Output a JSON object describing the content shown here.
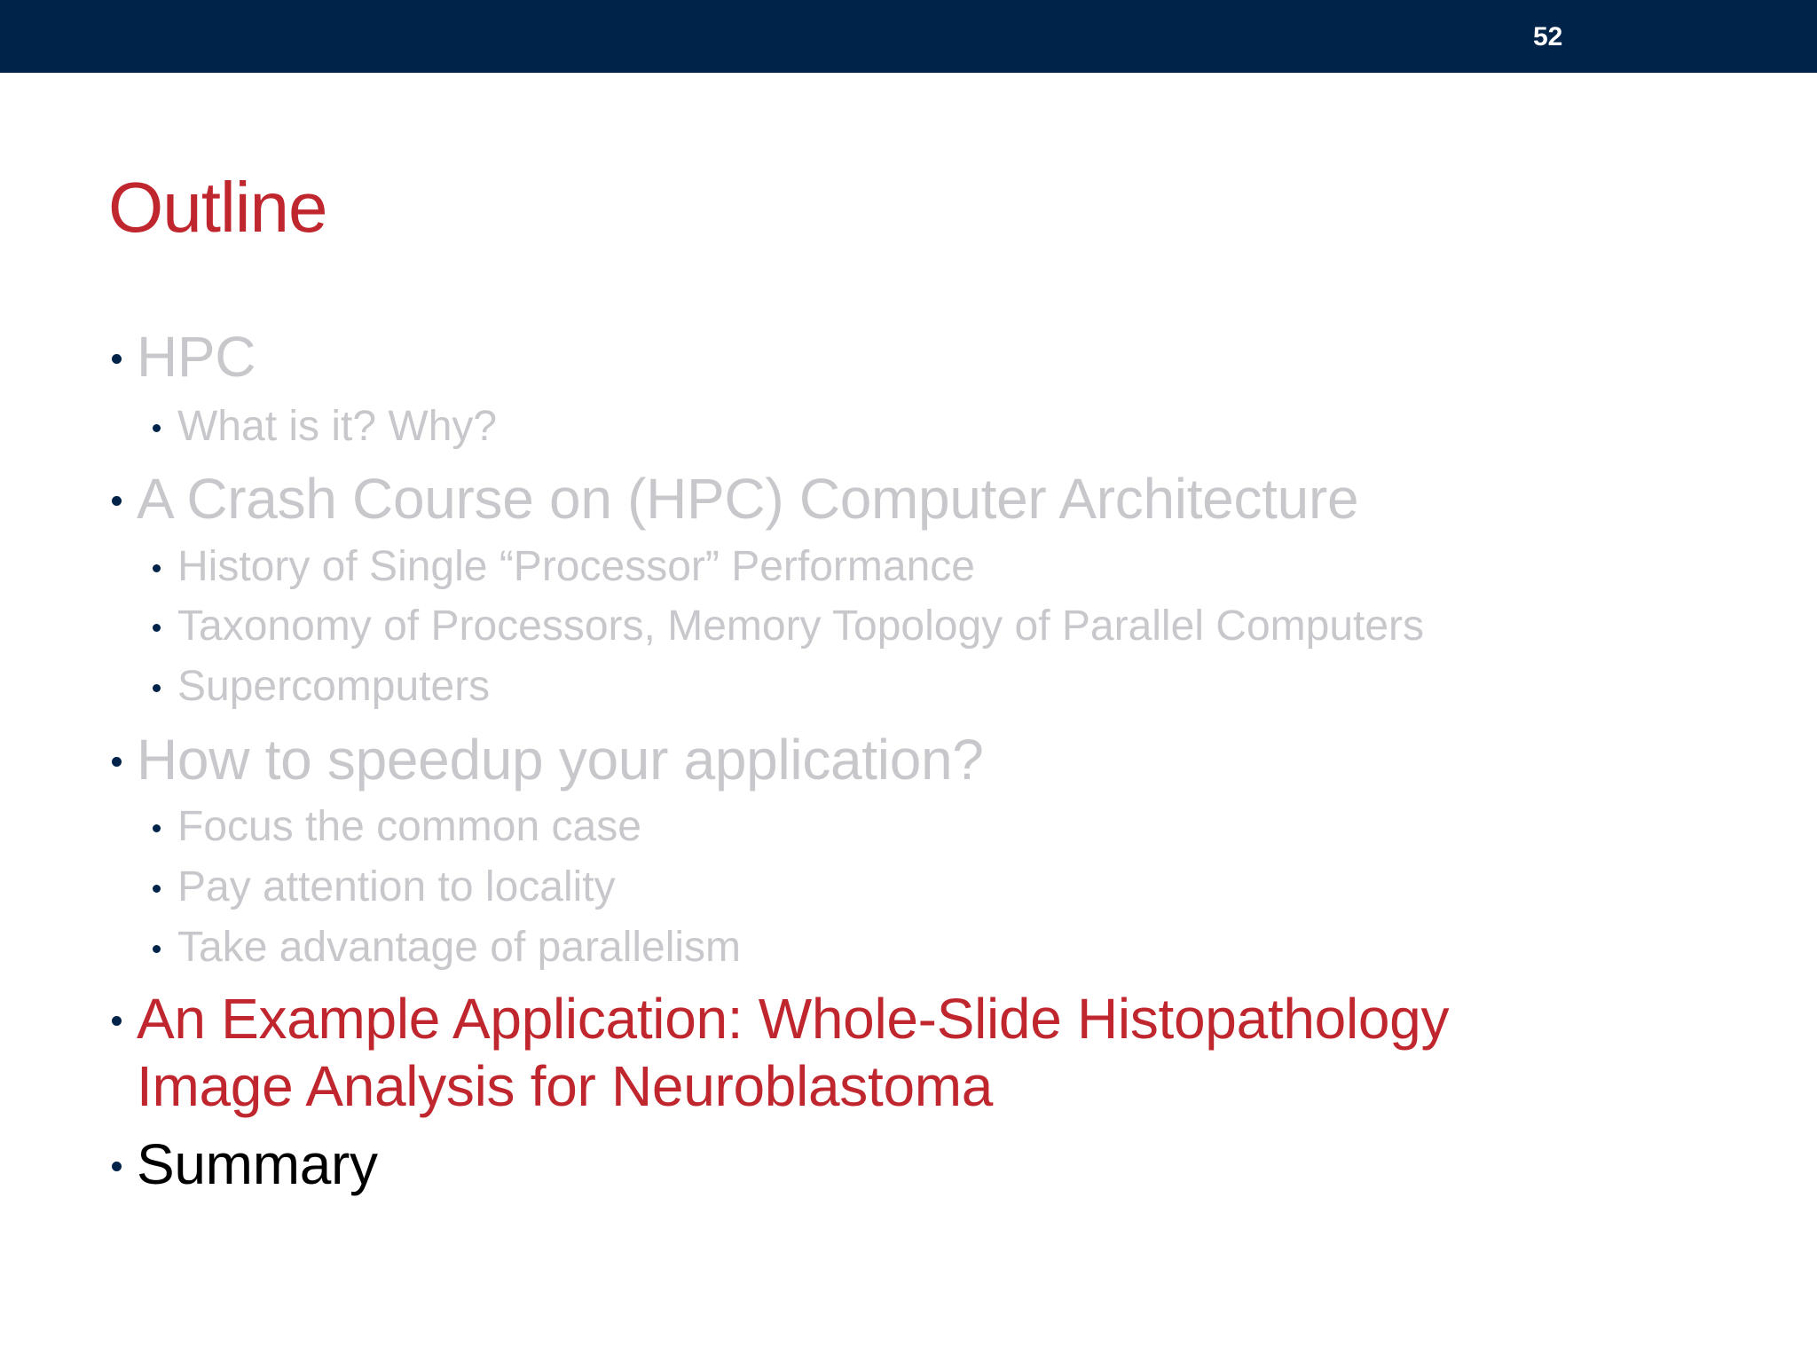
{
  "header": {
    "page_number": "52"
  },
  "title": "Outline",
  "outline": {
    "hpc": "HPC",
    "hpc_what": "What is it? Why?",
    "crash_course": "A Crash Course on (HPC) Computer Architecture",
    "history": "History of Single “Processor” Performance",
    "taxonomy": "Taxonomy of Processors, Memory Topology of Parallel Computers",
    "supercomputers": "Supercomputers",
    "speedup": "How to speedup your application?",
    "focus": "Focus the common case",
    "locality": "Pay attention to locality",
    "parallelism": "Take advantage of parallelism",
    "example_line1": "An Example Application: Whole-Slide Histopathology",
    "example_line2": "Image Analysis for Neuroblastoma",
    "summary": "Summary"
  },
  "colors": {
    "header_bar": "#00234a",
    "title": "#c0262d",
    "active_item": "#c0262d",
    "muted_item": "#c8c8cc",
    "bullet": "#00234a"
  }
}
